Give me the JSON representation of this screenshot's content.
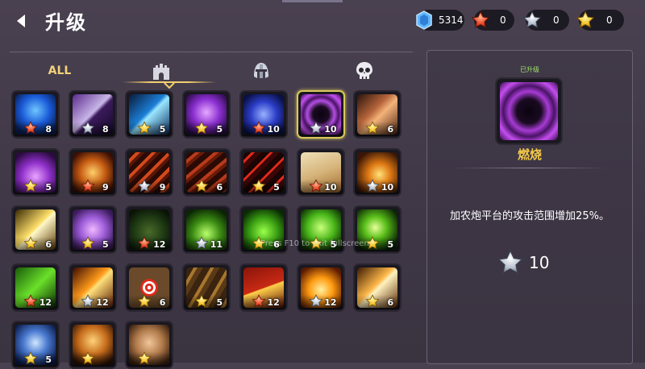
{
  "header": {
    "title": "升级"
  },
  "currencies": [
    {
      "icon": "gem-icon",
      "value": "5314"
    },
    {
      "icon": "red-star-icon",
      "value": "0"
    },
    {
      "icon": "silver-star-icon",
      "value": "0"
    },
    {
      "icon": "gold-star-icon",
      "value": "0"
    }
  ],
  "tabs": {
    "all_label": "ALL",
    "items": [
      "castle-tab-icon",
      "helmet-tab-icon",
      "skull-tab-icon"
    ],
    "active": "castle"
  },
  "grid": [
    {
      "star": "red",
      "level": "8"
    },
    {
      "star": "silver",
      "level": "8"
    },
    {
      "star": "gold",
      "level": "5"
    },
    {
      "star": "gold",
      "level": "5"
    },
    {
      "star": "red",
      "level": "10"
    },
    {
      "star": "silver",
      "level": "10",
      "selected": true
    },
    {
      "star": "gold",
      "level": "6"
    },
    {
      "star": "gold",
      "level": "5"
    },
    {
      "star": "red",
      "level": "9"
    },
    {
      "star": "silver",
      "level": "9"
    },
    {
      "star": "gold",
      "level": "6"
    },
    {
      "star": "gold",
      "level": "5"
    },
    {
      "star": "red",
      "level": "10"
    },
    {
      "star": "silver",
      "level": "10"
    },
    {
      "star": "gold",
      "level": "6"
    },
    {
      "star": "gold",
      "level": "5"
    },
    {
      "star": "red",
      "level": "12"
    },
    {
      "star": "silver",
      "level": "11"
    },
    {
      "star": "gold",
      "level": "6"
    },
    {
      "star": "gold",
      "level": "5"
    },
    {
      "star": "gold",
      "level": "5"
    },
    {
      "star": "red",
      "level": "12"
    },
    {
      "star": "silver",
      "level": "12"
    },
    {
      "star": "gold",
      "level": "6"
    },
    {
      "star": "gold",
      "level": "5"
    },
    {
      "star": "red",
      "level": "12"
    },
    {
      "star": "silver",
      "level": "12"
    },
    {
      "star": "gold",
      "level": "6"
    },
    {
      "star": "gold",
      "level": "5"
    },
    {
      "star": "gold",
      "level": ""
    },
    {
      "star": "gold",
      "level": ""
    }
  ],
  "detail": {
    "badge": "已升级",
    "name": "燃烧",
    "description": "加农炮平台的攻击范围增加25%。",
    "cost_star": "silver",
    "cost_value": "10"
  },
  "overlay_text": "Press F10 to exit fullscreen",
  "colors": {
    "gold": "#f2c84a",
    "red": "#e04a2a",
    "silver": "#b9c0cc",
    "selected_border": "#d9c85a"
  }
}
